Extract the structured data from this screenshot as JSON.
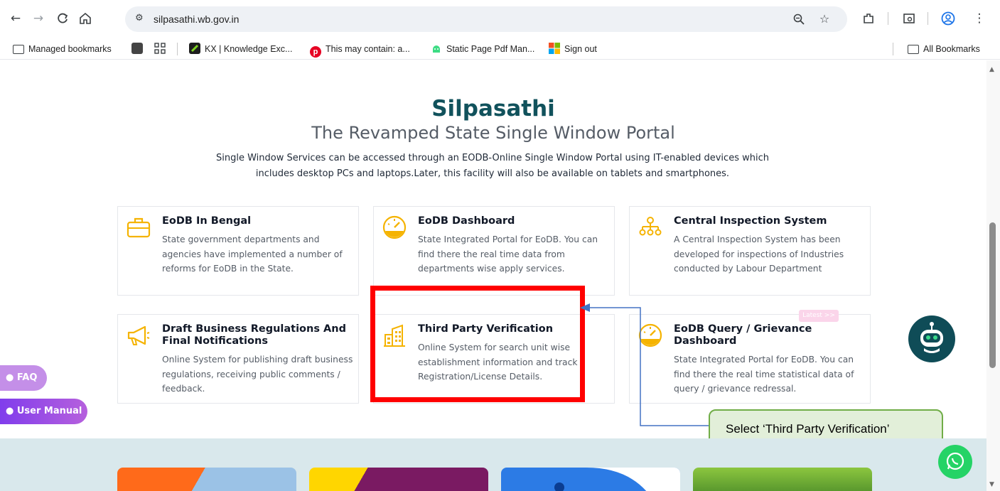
{
  "browser": {
    "url": "silpasathi.wb.gov.in",
    "bookmarks": [
      {
        "label": "Managed bookmarks",
        "icon": "managed-folder-icon"
      },
      {
        "label": "",
        "icon": "dark-square-icon"
      },
      {
        "label": "",
        "icon": "apps-grid-icon"
      },
      {
        "label": "KX | Knowledge Exc...",
        "icon": "kx-icon"
      },
      {
        "label": "This may contain: a...",
        "icon": "pinterest-icon"
      },
      {
        "label": "Static Page Pdf Man...",
        "icon": "android-icon"
      },
      {
        "label": "Sign out",
        "icon": "microsoft-icon"
      }
    ],
    "all_bookmarks": "All Bookmarks"
  },
  "hero": {
    "title": "Silpasathi",
    "subtitle": "The Revamped State Single Window Portal",
    "description": "Single Window Services can be accessed through an EODB-Online Single Window Portal using IT-enabled devices which includes desktop PCs and laptops.Later, this facility will also be available on tablets and smartphones."
  },
  "cards": [
    {
      "title": "EoDB In Bengal",
      "desc": "State government departments and agencies have implemented a number of reforms for EoDB in the State.",
      "icon": "briefcase-icon"
    },
    {
      "title": "EoDB Dashboard",
      "desc": "State Integrated Portal for EoDB. You can find there the real time data from departments wise apply services.",
      "icon": "speedometer-icon"
    },
    {
      "title": "Central Inspection System",
      "desc": "A Central Inspection System has been developed for inspections of Industries conducted by Labour Department",
      "icon": "org-chart-icon"
    },
    {
      "title": "Draft Business Regulations And Final Notifications",
      "desc": "Online System for publishing draft business regulations, receiving public comments / feedback.",
      "icon": "megaphone-icon"
    },
    {
      "title": "Third Party Verification",
      "desc": "Online System for search unit wise establishment information and track Registration/License Details.",
      "icon": "buildings-icon"
    },
    {
      "title": "EoDB Query / Grievance Dashboard",
      "desc": "State Integrated Portal for EoDB. You can find there the real time statistical data of query / grievance redressal.",
      "icon": "speedometer-icon"
    }
  ],
  "latest_badge": "Latest >>",
  "side_buttons": {
    "faq": "FAQ",
    "user_manual": "User Manual"
  },
  "callout": "Select ‘Third Party Verification’",
  "colors": {
    "title": "#11525c",
    "icon_yellow": "#f5b301",
    "highlight_red": "#ff0000",
    "callout_bg": "#e2efd9",
    "callout_border": "#70ad47",
    "arrow": "#4472c4"
  }
}
